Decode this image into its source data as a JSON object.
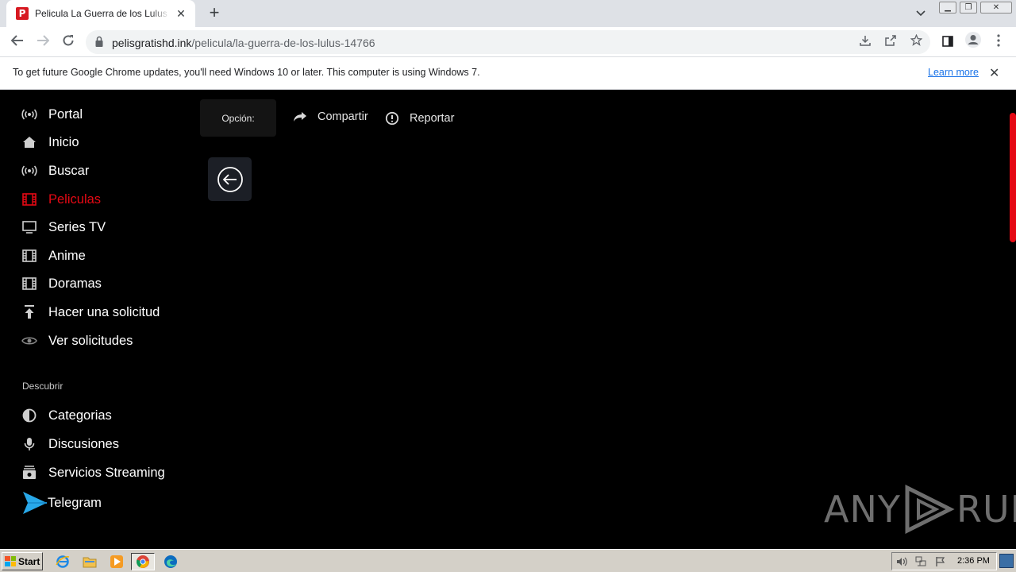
{
  "browser": {
    "tab_title": "Pelicula La Guerra de los Lulus Español",
    "tab_favicon_letter": "P",
    "url_host": "pelisgratishd.ink",
    "url_path": "/pelicula/la-guerra-de-los-lulus-14766"
  },
  "infobar": {
    "message": "To get future Google Chrome updates, you'll need Windows 10 or later. This computer is using Windows 7.",
    "link": "Learn more"
  },
  "sidebar": {
    "items": [
      {
        "label": "Portal",
        "icon": "broadcast-icon"
      },
      {
        "label": "Inicio",
        "icon": "home-icon"
      },
      {
        "label": "Buscar",
        "icon": "broadcast-icon"
      },
      {
        "label": "Peliculas",
        "icon": "film-icon",
        "active": true
      },
      {
        "label": "Series TV",
        "icon": "tv-icon"
      },
      {
        "label": "Anime",
        "icon": "film-icon"
      },
      {
        "label": "Doramas",
        "icon": "film-icon"
      },
      {
        "label": "Hacer una solicitud",
        "icon": "upload-icon"
      },
      {
        "label": "Ver solicitudes",
        "icon": "eye-icon"
      }
    ],
    "section_label": "Descubrir",
    "discover": [
      {
        "label": "Categorias",
        "icon": "half-circle-icon"
      },
      {
        "label": "Discusiones",
        "icon": "microphone-icon"
      },
      {
        "label": "Servicios Streaming",
        "icon": "streaming-icon"
      },
      {
        "label": "Telegram",
        "icon": "telegram-icon"
      }
    ]
  },
  "content": {
    "option_label": "Opción:",
    "share_label": "Compartir",
    "report_label": "Reportar"
  },
  "watermark": {
    "text_left": "ANY",
    "text_right": "RUN"
  },
  "taskbar": {
    "start_label": "Start",
    "clock": "2:36 PM"
  },
  "colors": {
    "accent": "#e50914",
    "page_bg": "#000000",
    "link": "#1a73e8"
  }
}
